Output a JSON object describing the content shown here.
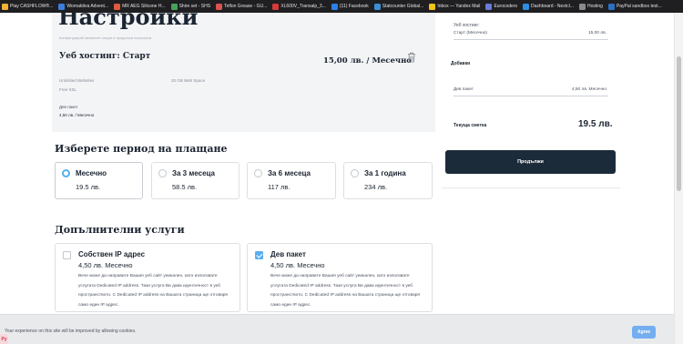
{
  "bookmarks": [
    {
      "label": "Play CASHFLOW®...",
      "color": "#f2b134"
    },
    {
      "label": "Wornaktiva Advent...",
      "color": "#3c7ddc"
    },
    {
      "label": "MR AEG Silicone H...",
      "color": "#e05a3d"
    },
    {
      "label": "Shire set - SHS",
      "color": "#47a35a"
    },
    {
      "label": "Teflon Grease - GU...",
      "color": "#d9534f"
    },
    {
      "label": "XL600V_Transalp_3...",
      "color": "#d63a3a"
    },
    {
      "label": "(11) Facebook",
      "color": "#2d7fe8"
    },
    {
      "label": "Statcounter Global...",
      "color": "#3a8fd6"
    },
    {
      "label": "Inbox — Yandex Mail",
      "color": "#f0c419"
    },
    {
      "label": "Eurocoders",
      "color": "#6a7bd8"
    },
    {
      "label": "Dashboard - Nextcl...",
      "color": "#2f8ce0"
    },
    {
      "label": "Hosting",
      "color": "#8a8a8a"
    },
    {
      "label": "PayPal sandbox test...",
      "color": "#2b6fc2"
    }
  ],
  "config": {
    "title": "Настройки",
    "subtitle": "Конфигурирай желаните опции и продължи поръчката",
    "plan_name": "Уеб хостинг: Старт",
    "plan_price": "15,00 лв. / Месечно",
    "features": [
      "Unlimited Websites",
      "20 GB Web Space",
      "Free SSL"
    ],
    "dev_label": "Дев пакет",
    "dev_price": "4,50 лв. / Месечно"
  },
  "period": {
    "title": "Изберете период на плащане",
    "options": [
      {
        "name": "Месечно",
        "price": "19.5 лв.",
        "selected": true
      },
      {
        "name": "За 3 месеца",
        "price": "58.5 лв.",
        "selected": false
      },
      {
        "name": "За 6 месеца",
        "price": "117 лв.",
        "selected": false
      },
      {
        "name": "За 1 година",
        "price": "234 лв.",
        "selected": false
      }
    ]
  },
  "services": {
    "title": "Допълнителни услуги",
    "items": [
      {
        "name": "Собствен IP адрес",
        "price": "4,50 лв. Месечно",
        "checked": false,
        "desc": "Вече може да направите Вашия уеб сайт уникален, като използвате услугата Dedicated IP address. Тази услуга Ви дава идентичност в уеб пространството. С Dedicated IP address на Вашата страница ще отговаря само един IP адрес."
      },
      {
        "name": "Дев пакет",
        "price": "4,50 лв. Месечно",
        "checked": true,
        "desc": "Вече може да направите Вашия уеб сайт уникален, като използвате услугата Dedicated IP address. Тази услуга Ви дава идентичност в уеб пространството. С Dedicated IP address на Вашата страница ще отговаря само един IP адрес."
      }
    ]
  },
  "summary": {
    "hosting_head": "Уеб хостинг:",
    "hosting_item": "Старт (Месечно)",
    "hosting_price": "15,00 лв.",
    "addons_title": "Добавки",
    "addon_item": "Дев пакет",
    "addon_price": "4,50 лв. Месечно",
    "total_label": "Текуща сметка",
    "total_value": "19.5 лв.",
    "continue_label": "Продължи"
  },
  "cookie": {
    "text": "Your experience on this site will be improved by allowing cookies.",
    "agree_label": "Agree",
    "badge": "Ру"
  }
}
